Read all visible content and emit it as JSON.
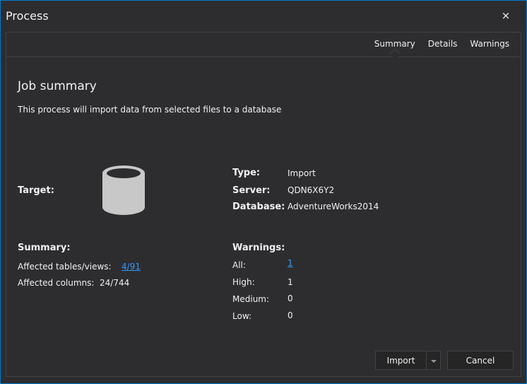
{
  "window": {
    "title": "Process",
    "close_icon": "×",
    "accent_color": "#007acc"
  },
  "tabs": [
    {
      "label": "Summary",
      "active": true
    },
    {
      "label": "Details",
      "active": false
    },
    {
      "label": "Warnings",
      "active": false
    }
  ],
  "content": {
    "heading": "Job summary",
    "description": "This process will import data from selected files to a database",
    "target": {
      "label": "Target:",
      "icon": "database-icon"
    },
    "details": {
      "type_label": "Type:",
      "type_value": "Import",
      "server_label": "Server:",
      "server_value": "QDN6X6Y2",
      "database_label": "Database:",
      "database_value": "AdventureWorks2014"
    },
    "summary": {
      "label": "Summary:",
      "tables_label": "Affected tables/views:",
      "tables_value": "4/91",
      "columns_label": "Affected columns:",
      "columns_value": "24/744"
    },
    "warnings": {
      "label": "Warnings:",
      "all_label": "All:",
      "all_value": "1",
      "high_label": "High:",
      "high_value": "1",
      "medium_label": "Medium:",
      "medium_value": "0",
      "low_label": "Low:",
      "low_value": "0"
    }
  },
  "buttons": {
    "import_label": "Import",
    "cancel_label": "Cancel"
  }
}
